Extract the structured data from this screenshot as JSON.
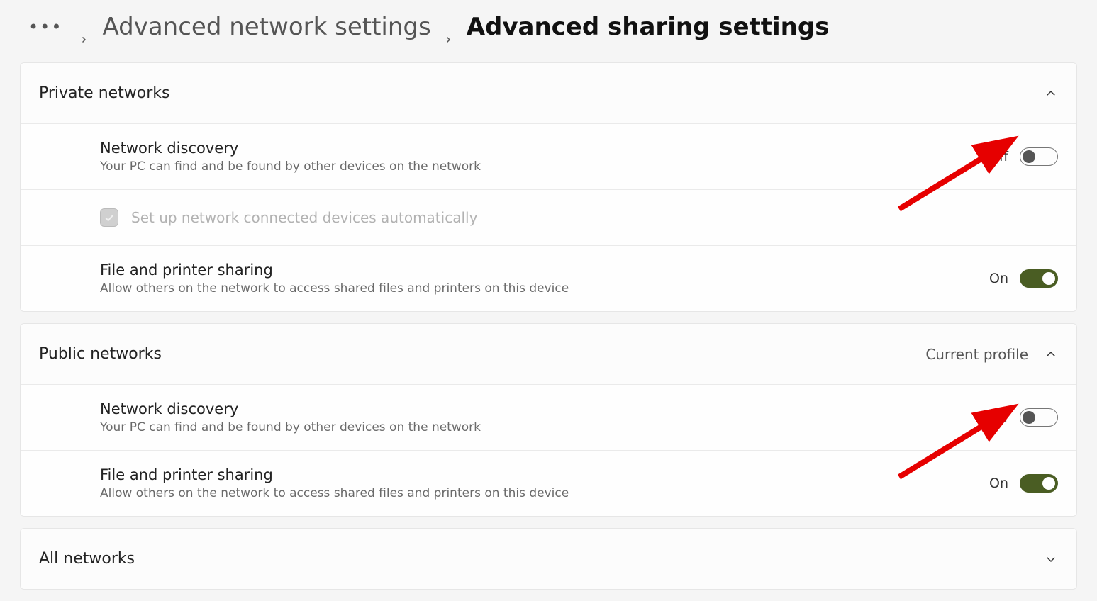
{
  "breadcrumb": {
    "parent": "Advanced network settings",
    "current": "Advanced sharing settings"
  },
  "sections": {
    "private": {
      "title": "Private networks",
      "expanded": true,
      "profile_tag": "",
      "network_discovery": {
        "title": "Network discovery",
        "desc": "Your PC can find and be found by other devices on the network",
        "state_label": "Off",
        "on": false
      },
      "auto_setup": {
        "label": "Set up network connected devices automatically",
        "checked": true,
        "disabled": true
      },
      "file_printer": {
        "title": "File and printer sharing",
        "desc": "Allow others on the network to access shared files and printers on this device",
        "state_label": "On",
        "on": true
      }
    },
    "public": {
      "title": "Public networks",
      "expanded": true,
      "profile_tag": "Current profile",
      "network_discovery": {
        "title": "Network discovery",
        "desc": "Your PC can find and be found by other devices on the network",
        "state_label": "Off",
        "on": false
      },
      "file_printer": {
        "title": "File and printer sharing",
        "desc": "Allow others on the network to access shared files and printers on this device",
        "state_label": "On",
        "on": true
      }
    },
    "all": {
      "title": "All networks",
      "expanded": false,
      "profile_tag": ""
    }
  }
}
